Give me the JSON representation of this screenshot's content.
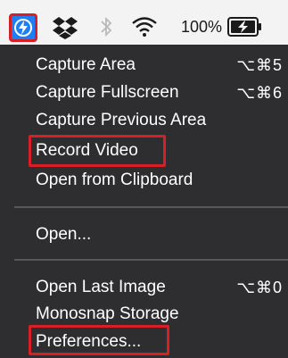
{
  "menubar": {
    "icons": [
      "monosnap-bolt-icon",
      "dropbox-icon",
      "bluetooth-icon",
      "wifi-icon",
      "battery-charging-icon"
    ],
    "battery_percent": "100%"
  },
  "menu": {
    "items": [
      {
        "label": "Capture Area",
        "shortcut": "⌥⌘5"
      },
      {
        "label": "Capture Fullscreen",
        "shortcut": "⌥⌘6"
      },
      {
        "label": "Capture Previous Area",
        "shortcut": ""
      },
      {
        "label": "Record Video",
        "shortcut": ""
      },
      {
        "label": "Open from Clipboard",
        "shortcut": ""
      },
      {
        "label": "Open...",
        "shortcut": ""
      },
      {
        "label": "Open Last Image",
        "shortcut": "⌥⌘0"
      },
      {
        "label": "Monosnap Storage",
        "shortcut": ""
      },
      {
        "label": "Preferences...",
        "shortcut": ""
      }
    ]
  },
  "colors": {
    "menu_bg": "#2e2e30",
    "highlight": "#d81f26",
    "app_icon_bg": "#1e7ef6"
  }
}
